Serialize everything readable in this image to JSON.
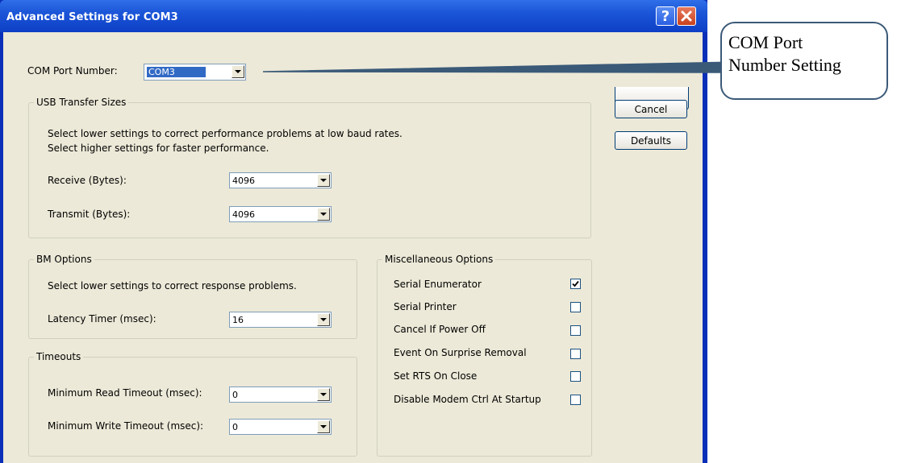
{
  "window": {
    "title": "Advanced Settings for COM3",
    "help_glyph": "?",
    "close_glyph": "✕"
  },
  "com_port": {
    "label": "COM Port Number:",
    "value": "COM3"
  },
  "buttons": {
    "cancel": "Cancel",
    "defaults": "Defaults"
  },
  "usb_transfer": {
    "title": "USB Transfer Sizes",
    "desc1": "Select lower settings to correct performance problems at low baud rates.",
    "desc2": "Select higher settings for faster performance.",
    "receive_label": "Receive (Bytes):",
    "receive_value": "4096",
    "transmit_label": "Transmit (Bytes):",
    "transmit_value": "4096"
  },
  "bm_options": {
    "title": "BM Options",
    "desc": "Select lower settings to correct response problems.",
    "latency_label": "Latency Timer (msec):",
    "latency_value": "16"
  },
  "timeouts": {
    "title": "Timeouts",
    "read_label": "Minimum Read Timeout (msec):",
    "read_value": "0",
    "write_label": "Minimum Write Timeout (msec):",
    "write_value": "0"
  },
  "misc": {
    "title": "Miscellaneous Options",
    "items": [
      {
        "label": "Serial Enumerator",
        "checked": true
      },
      {
        "label": "Serial Printer",
        "checked": false
      },
      {
        "label": "Cancel If Power Off",
        "checked": false
      },
      {
        "label": "Event On Surprise Removal",
        "checked": false
      },
      {
        "label": "Set RTS On Close",
        "checked": false
      },
      {
        "label": "Disable Modem Ctrl At Startup",
        "checked": false
      }
    ]
  },
  "callout": {
    "line1": "COM Port",
    "line2": "Number Setting"
  },
  "icons": {
    "dropdown": "chevron-down-icon",
    "check": "checkmark-icon"
  },
  "colors": {
    "titlebar": "#1b55d8",
    "client_bg": "#ece9d8",
    "selection": "#316ac5",
    "close": "#c9421e"
  }
}
